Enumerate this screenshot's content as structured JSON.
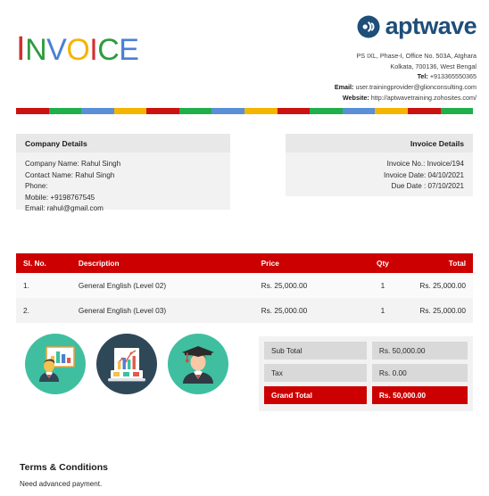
{
  "document": {
    "title_letters": [
      {
        "ch": "I",
        "color": "#D32F2F"
      },
      {
        "ch": "N",
        "color": "#2E9B3E"
      },
      {
        "ch": "V",
        "color": "#4A7FD4"
      },
      {
        "ch": "O",
        "color": "#F5B400"
      },
      {
        "ch": "I",
        "color": "#D32F2F"
      },
      {
        "ch": "C",
        "color": "#2E9B3E"
      },
      {
        "ch": "E",
        "color": "#4A7FD4"
      }
    ],
    "title_text": "INVOICE"
  },
  "brand": {
    "name": "aptwave",
    "logo_icon": "soundwave-circle-icon",
    "color": "#1F4E79",
    "address_line1": "PS IXL, Phase-I, Office No. 503A, Atghara",
    "address_line2": "Kolkata, 700136, West Bengal",
    "tel_label": "Tel:",
    "tel_value": "+913365550365",
    "email_label": "Email:",
    "email_value": "user.trainingprovider@glionconsulting.com",
    "website_label": "Website:",
    "website_value": "http://aptwavetraining.zohosites.com/"
  },
  "colorbar": {
    "colors": [
      "#CC1111",
      "#1FAF4B",
      "#5A8FD8",
      "#F5B400",
      "#CC1111",
      "#1FAF4B",
      "#5A8FD8",
      "#F5B400",
      "#CC1111",
      "#1FAF4B",
      "#5A8FD8",
      "#F5B400",
      "#CC1111",
      "#1FAF4B"
    ]
  },
  "company_details": {
    "heading": "Company Details",
    "lines": [
      "Company Name: Rahul Singh",
      "Contact Name: Rahul Singh",
      "Phone:",
      "Mobile: +9198767545",
      "Email: rahul@gmail.com"
    ]
  },
  "invoice_details": {
    "heading": "Invoice Details",
    "lines": [
      "Invoice No.: Invoice/194",
      "Invoice Date: 04/10/2021",
      "Due Date : 07/10/2021"
    ]
  },
  "items_table": {
    "header_color": "#CC0000",
    "columns": [
      "Sl. No.",
      "Description",
      "Price",
      "Qty",
      "Total"
    ],
    "rows": [
      {
        "sl": "1.",
        "description": "General English (Level 02)",
        "price": "Rs. 25,000.00",
        "qty": "1",
        "total": "Rs. 25,000.00"
      },
      {
        "sl": "2.",
        "description": "General English (Level 03)",
        "price": "Rs. 25,000.00",
        "qty": "1",
        "total": "Rs. 25,000.00"
      }
    ]
  },
  "icons": [
    {
      "name": "presenter-bar-chart-icon",
      "background": "#3FBFA0"
    },
    {
      "name": "laptop-analytics-icon",
      "background": "#2F4858"
    },
    {
      "name": "graduate-student-icon",
      "background": "#3FBFA0"
    }
  ],
  "totals": {
    "sub_total_label": "Sub Total",
    "sub_total_value": "Rs. 50,000.00",
    "tax_label": "Tax",
    "tax_value": "Rs. 0.00",
    "grand_total_label": "Grand Total",
    "grand_total_value": "Rs. 50,000.00",
    "grand_total_color": "#CC0000"
  },
  "terms": {
    "heading": "Terms & Conditions",
    "text": "Need advanced payment."
  }
}
